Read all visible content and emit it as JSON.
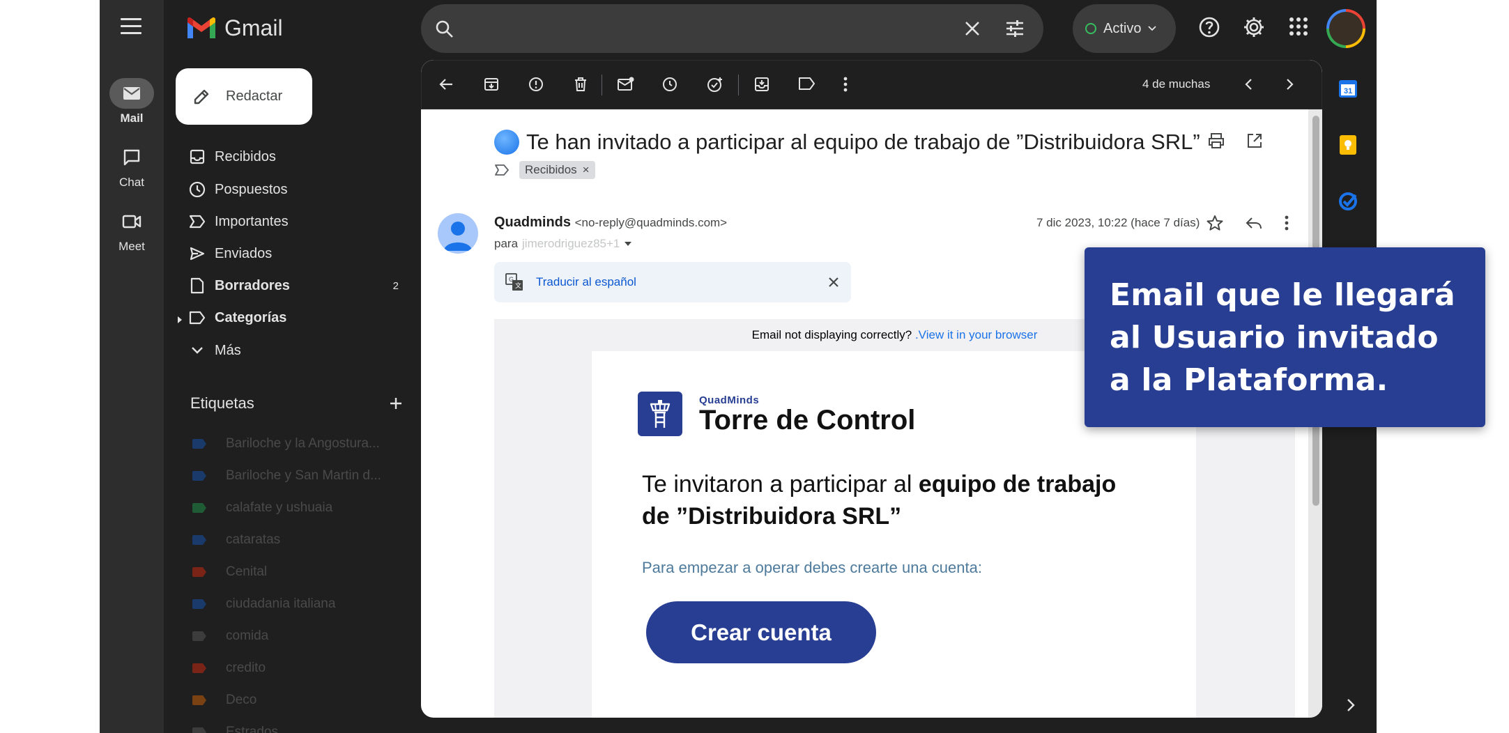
{
  "app": {
    "name": "Gmail"
  },
  "rail": {
    "items": [
      {
        "label": "Mail",
        "icon": "mail-icon"
      },
      {
        "label": "Chat",
        "icon": "chat-icon"
      },
      {
        "label": "Meet",
        "icon": "video-icon"
      }
    ]
  },
  "nav": {
    "compose_label": "Redactar",
    "items": [
      {
        "label": "Recibidos",
        "icon": "inbox-icon",
        "bold": false
      },
      {
        "label": "Pospuestos",
        "icon": "clock-icon",
        "bold": false
      },
      {
        "label": "Importantes",
        "icon": "important-icon",
        "bold": false
      },
      {
        "label": "Enviados",
        "icon": "send-icon",
        "bold": false
      },
      {
        "label": "Borradores",
        "icon": "draft-icon",
        "bold": true,
        "count": "2"
      },
      {
        "label": "Categorías",
        "icon": "label-icon",
        "bold": true
      },
      {
        "label": "Más",
        "icon": "chevron-down-icon",
        "bold": false
      }
    ],
    "labels_heading": "Etiquetas",
    "labels": [
      {
        "label": "Bariloche y la Angostura...",
        "color": "#1a3a6b"
      },
      {
        "label": "Bariloche y San Martin d...",
        "color": "#1a3a6b"
      },
      {
        "label": "calafate y ushuaia",
        "color": "#1f5b35"
      },
      {
        "label": "cataratas",
        "color": "#1a3a6b"
      },
      {
        "label": "Cenital",
        "color": "#7a2418"
      },
      {
        "label": "ciudadania italiana",
        "color": "#1a3a6b"
      },
      {
        "label": "comida",
        "color": "#3c3c3c"
      },
      {
        "label": "credito",
        "color": "#7a2418"
      },
      {
        "label": "Deco",
        "color": "#7a4213"
      },
      {
        "label": "Estrados",
        "color": "#3c3c3c"
      }
    ]
  },
  "topbar": {
    "search_placeholder": "",
    "status_label": "Activo"
  },
  "toolbar": {
    "pager": "4 de muchas"
  },
  "email": {
    "subject": "Te han invitado a participar al equipo de trabajo de ”Distribuidora SRL”",
    "label_chip": "Recibidos",
    "sender_name": "Quadminds",
    "sender_addr": "<no-reply@quadminds.com>",
    "to_prefix": "para",
    "to_recipient": "jimerodriguez85+1",
    "date": "7 dic 2023, 10:22 (hace 7 días)",
    "translate_label": "Traducir al español",
    "notice_text": "Email not displaying correctly? ",
    "notice_link": ".View it in your browser",
    "brand_small": "QuadMinds",
    "brand_big": "Torre de Control",
    "invite_plain": "Te invitaron a participar al ",
    "invite_bold": "equipo de trabajo de ”Distribuidora SRL”",
    "start_text": "Para empezar a operar debes crearte una cuenta:",
    "cta_label": "Crear cuenta"
  },
  "callout": {
    "text": "Email que le llegará al Usuario invitado a la Plataforma."
  },
  "colors": {
    "accent": "#283e93",
    "link": "#0b57d0",
    "status_green": "#37be5f"
  }
}
